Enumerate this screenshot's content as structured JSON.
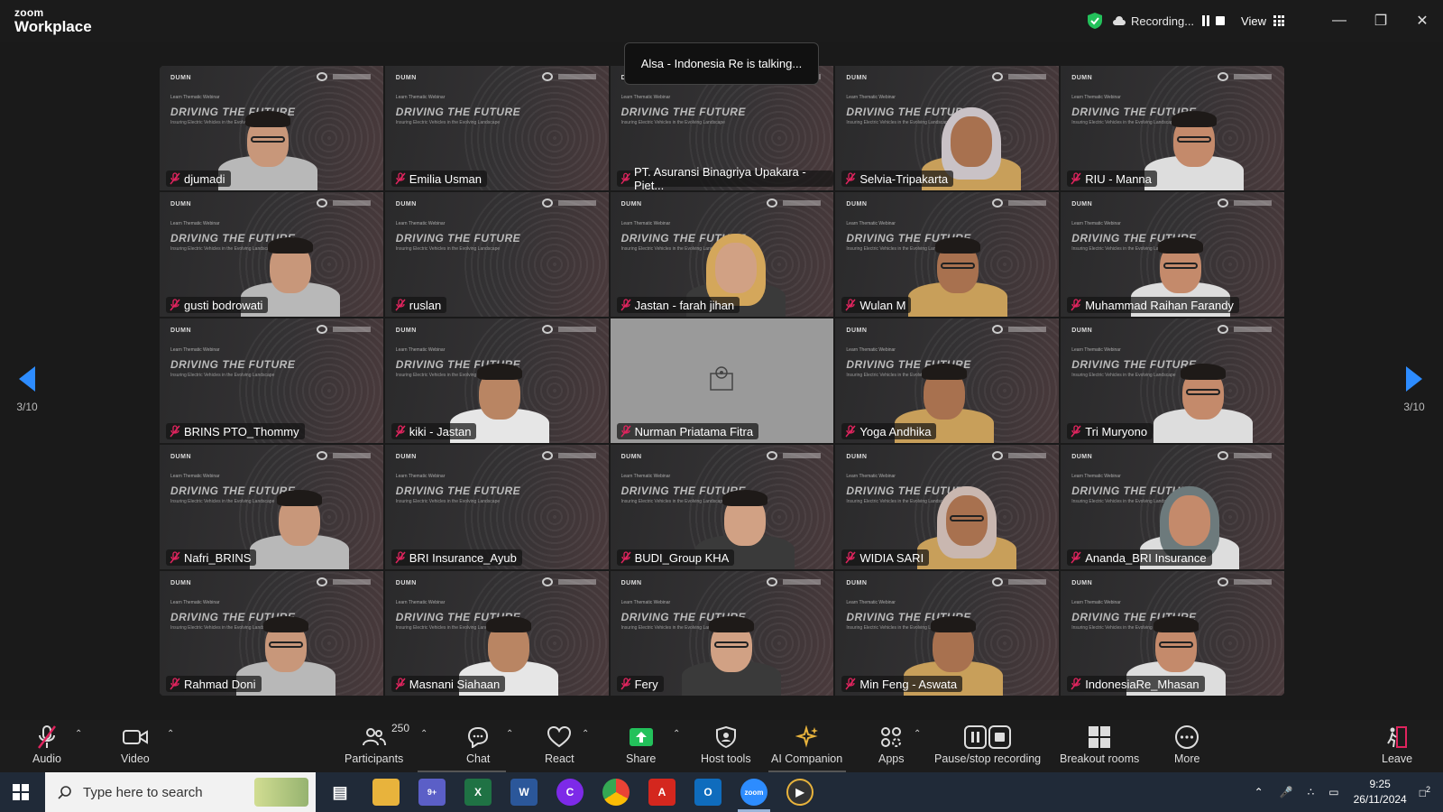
{
  "app": {
    "brand_small": "zoom",
    "brand_big": "Workplace"
  },
  "titlebar": {
    "recording_label": "Recording...",
    "view_label": "View"
  },
  "talking_banner": "Alsa - Indonesia Re is talking...",
  "pager": {
    "left": "3/10",
    "right": "3/10"
  },
  "tiles": [
    {
      "name": "djumadi"
    },
    {
      "name": "Emilia Usman"
    },
    {
      "name": "PT. Asuransi Binagriya Upakara - Piet..."
    },
    {
      "name": "Selvia-Tripakarta"
    },
    {
      "name": "RIU - Manna"
    },
    {
      "name": "gusti bodrowati"
    },
    {
      "name": "ruslan"
    },
    {
      "name": "Jastan - farah jihan"
    },
    {
      "name": "Wulan M"
    },
    {
      "name": "Muhammad Raihan Farandy"
    },
    {
      "name": "BRINS PTO_Thommy"
    },
    {
      "name": "kiki - Jastan"
    },
    {
      "name": "Nurman Priatama Fitra"
    },
    {
      "name": "Yoga Andhika"
    },
    {
      "name": "Tri Muryono"
    },
    {
      "name": "Nafri_BRINS"
    },
    {
      "name": "BRI Insurance_Ayub"
    },
    {
      "name": "BUDI_Group KHA"
    },
    {
      "name": "WIDIA SARI"
    },
    {
      "name": "Ananda_BRI Insurance"
    },
    {
      "name": "Rahmad Doni"
    },
    {
      "name": "Masnani Siahaan"
    },
    {
      "name": "Fery"
    },
    {
      "name": "Min Feng - Aswata"
    },
    {
      "name": "IndonesiaRe_Mhasan"
    }
  ],
  "slide": {
    "logo": "DUMN",
    "webinar": "Learn Thematic Webinar",
    "headline": "DRIVING THE FUTURE",
    "sub": "Insuring Electric Vehicles in the Evolving Landscape"
  },
  "toolbar": {
    "audio": "Audio",
    "video": "Video",
    "participants": "Participants",
    "participants_count": "250",
    "chat": "Chat",
    "react": "React",
    "share": "Share",
    "host_tools": "Host tools",
    "ai_companion": "AI Companion",
    "apps": "Apps",
    "pause_stop": "Pause/stop recording",
    "breakout": "Breakout rooms",
    "more": "More",
    "leave": "Leave"
  },
  "taskbar": {
    "search_placeholder": "Type here to search",
    "time": "9:25",
    "date": "26/11/2024",
    "notif_count": "2",
    "teams_badge": "9+"
  },
  "colors": {
    "accent": "#2d8cff",
    "muted_mic": "#e0245e",
    "share_green": "#23c15b"
  }
}
